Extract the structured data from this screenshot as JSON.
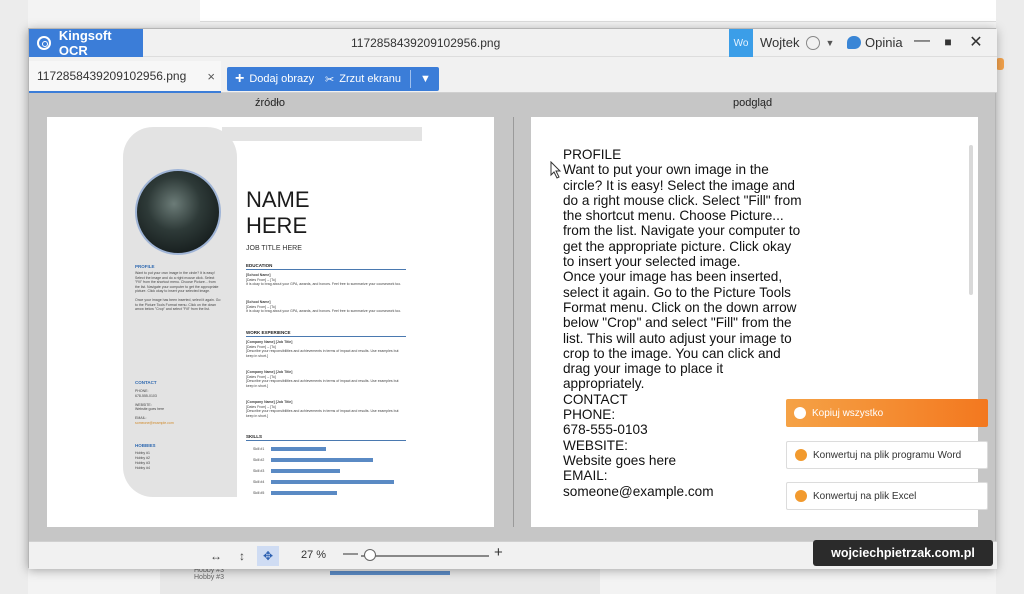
{
  "app": {
    "name": "Kingsoft OCR",
    "window_title": "1172858439209102956.png",
    "wo_label": "Wo",
    "user_name": "Wojtek",
    "opinion_label": "Opinia",
    "controls": {
      "minimize": "—",
      "maximize": "■",
      "close": "✕"
    }
  },
  "tabs": {
    "file_tab_label": "1172858439209102956.png",
    "close_glyph": "×",
    "add_images_label": "Dodaj obrazy",
    "screenshot_label": "Zrzut ekranu"
  },
  "panels": {
    "source_label": "źródło",
    "preview_label": "podgląd"
  },
  "resume": {
    "name_line1": "NAME",
    "name_line2": "HERE",
    "job_title": "JOB TITLE HERE",
    "education_heading": "EDUCATION",
    "work_heading": "WORK EXPERIENCE",
    "skills_heading": "SKILLS",
    "profile_heading": "PROFILE",
    "contact_heading": "CONTACT",
    "hobbies_heading": "HOBBIES",
    "school_1": "[School Name]",
    "school_2": "[School Name]",
    "company_1": "[Company Name] [Job Title]",
    "company_2": "[Company Name] [Job Title]",
    "company_3": "[Company Name] [Job Title]",
    "skills": [
      "Skill #1",
      "Skill #2",
      "Skill #3",
      "Skill #4",
      "Skill #5"
    ],
    "skill_levels": [
      0.42,
      0.77,
      0.52,
      0.93,
      0.5
    ],
    "hobbies": [
      "Hobby #1",
      "Hobby #2",
      "Hobby #3",
      "Hobby #4"
    ]
  },
  "ocr_text": "PROFILE\nWant to put your own image in the circle? It is easy! Select the image and do a right mouse click. Select \"Fill\" from the shortcut menu. Choose Picture... from the list. Navigate your computer to get the appropriate picture. Click okay to insert your selected image.\nOnce your image has been inserted, select it again. Go to the Picture Tools Format menu. Click on the down arrow below \"Crop\" and select \"Fill\" from the list. This will auto adjust your image to crop to the image. You can click and drag your image to place it appropriately.\nCONTACT\nPHONE:\n678-555-0103\nWEBSITE:\nWebsite goes here\nEMAIL:\nsomeone@example.com",
  "actions": {
    "copy_all": "Kopiuj wszystko",
    "to_word": "Konwertuj na plik programu Word",
    "to_excel": "Konwertuj na plik Excel"
  },
  "bottom": {
    "zoom_value": "27 %",
    "zoom_minus": "—",
    "zoom_plus": "+",
    "zoom_level": 0.27
  },
  "background": {
    "hobby_lines": [
      "Hobby #3",
      "Hobby #3"
    ]
  },
  "watermark": "wojciechpietrzak.com.pl",
  "colors": {
    "brand_blue": "#3b7dd8",
    "accent_orange": "#f3781f",
    "skill_bar": "#5a8ac4"
  }
}
